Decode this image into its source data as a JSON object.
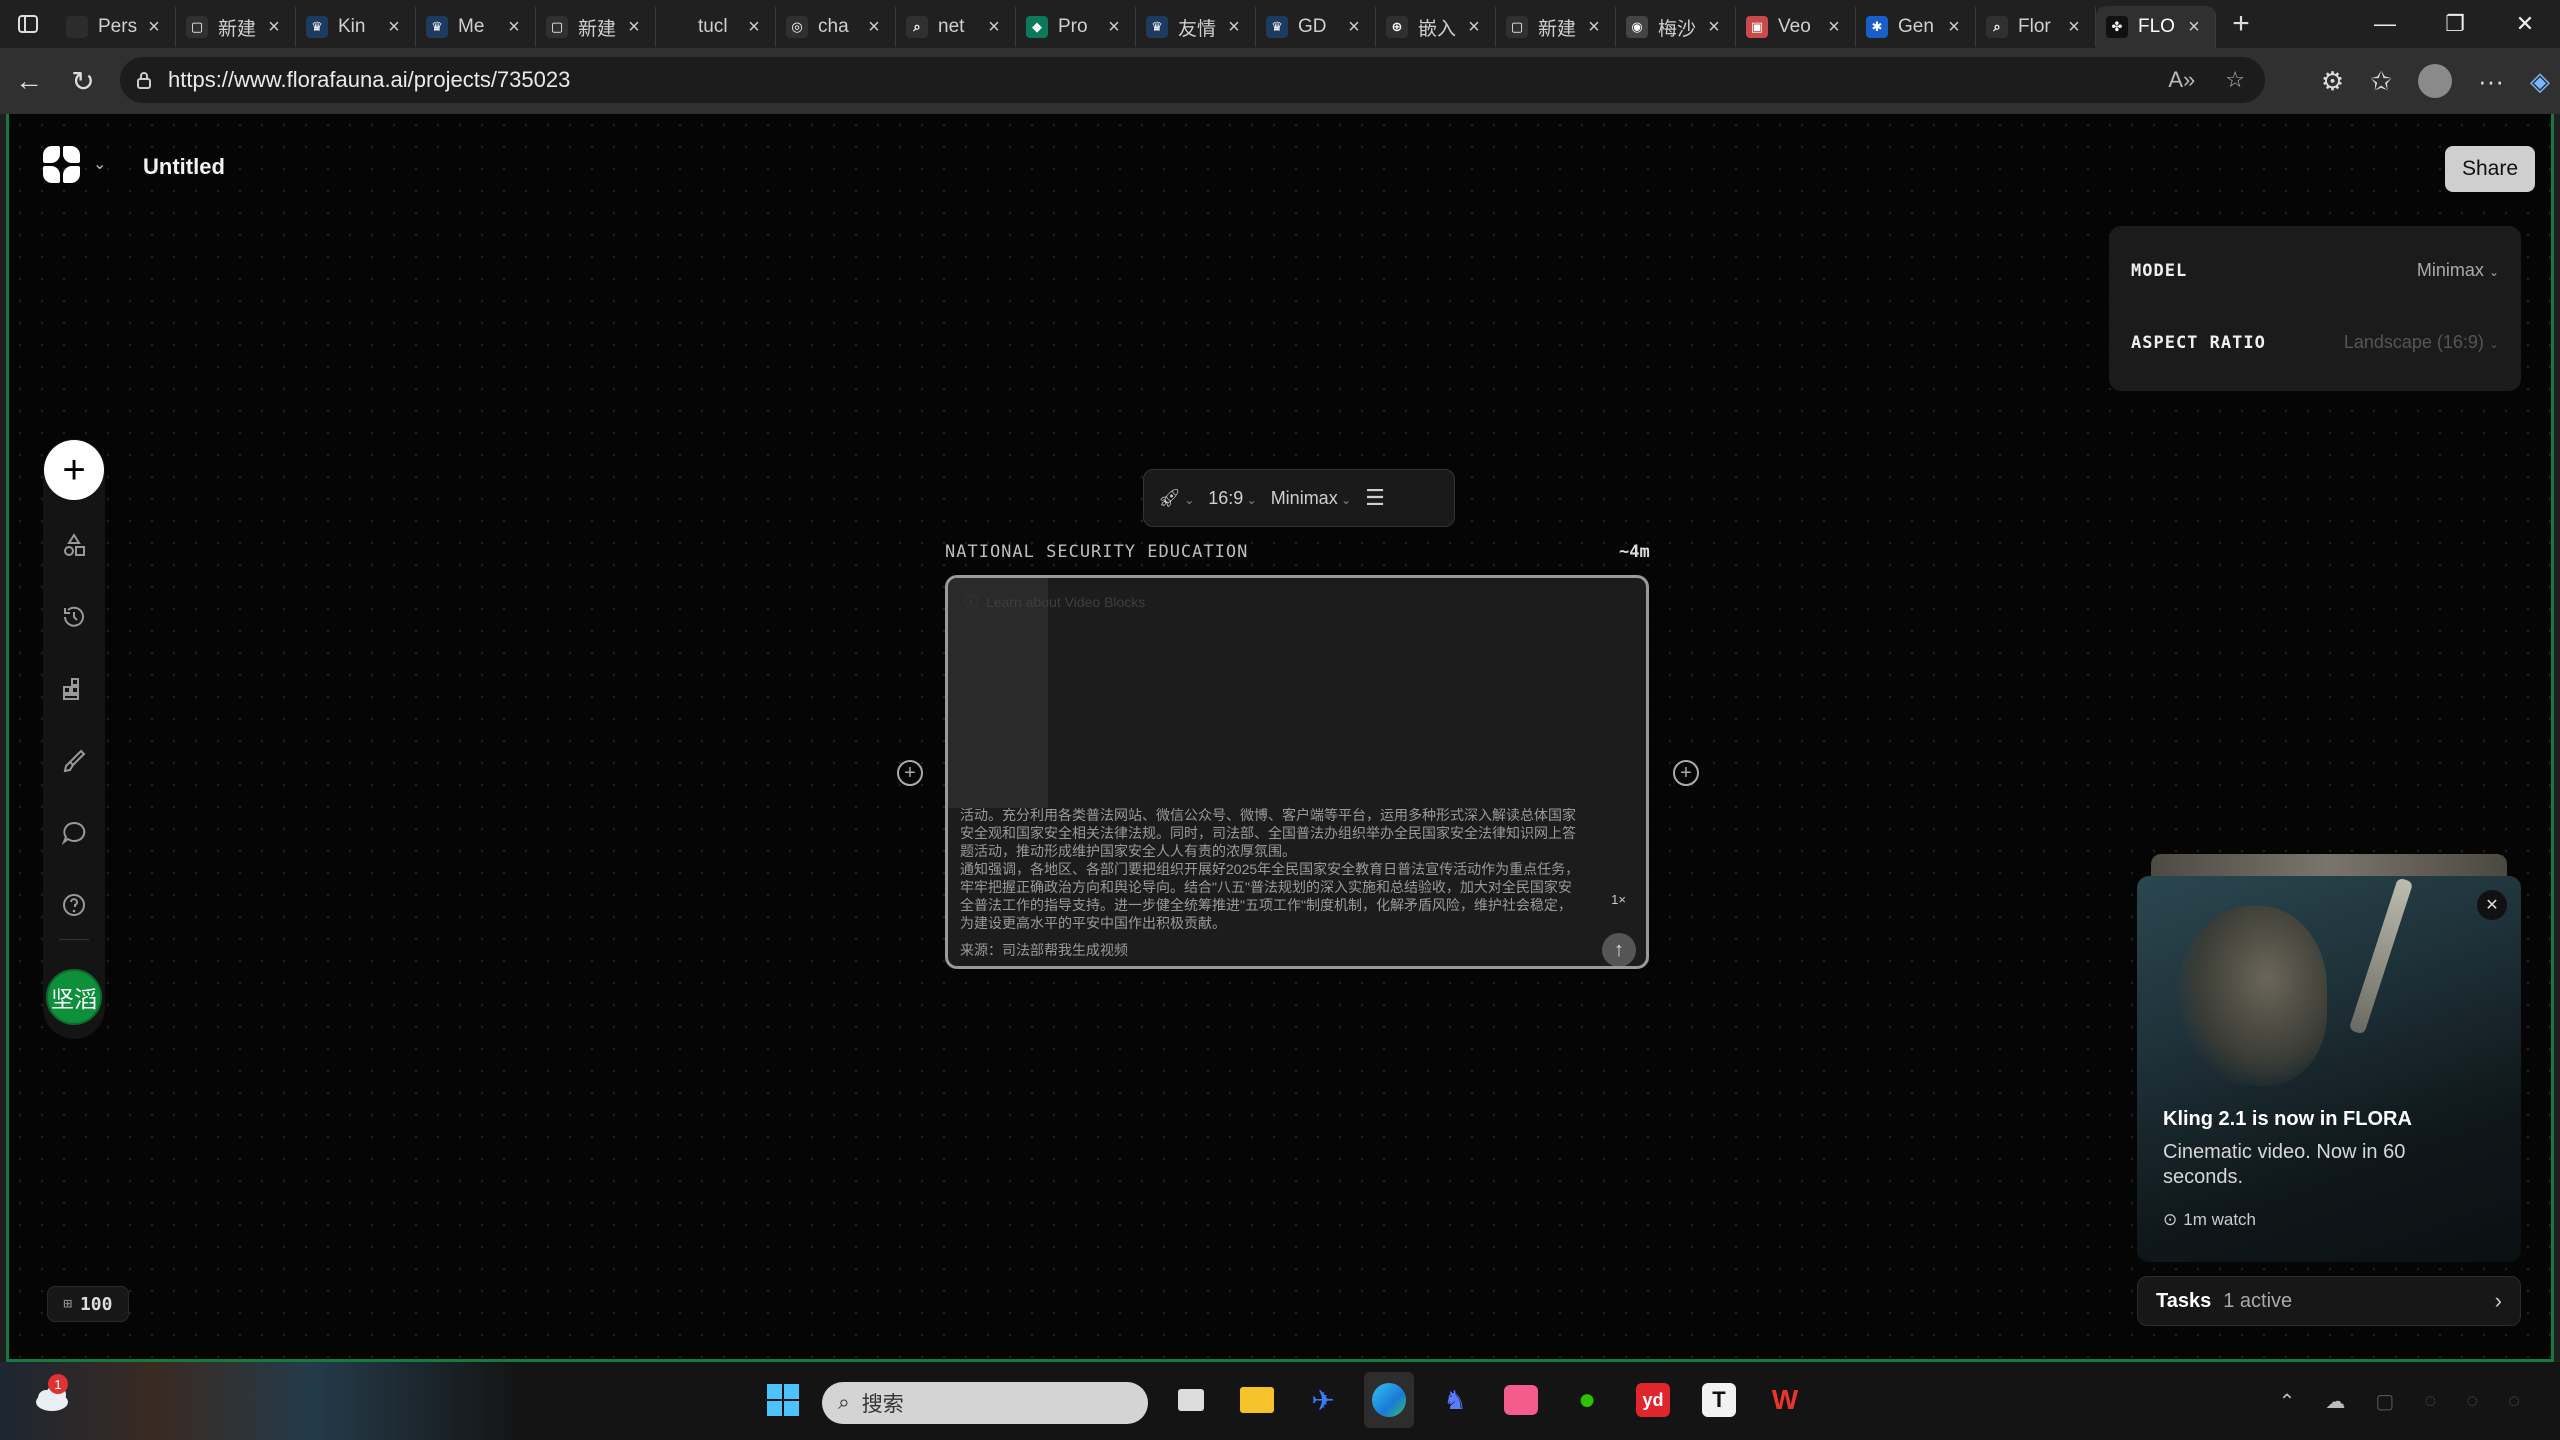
{
  "browser": {
    "tabs": [
      {
        "label": "Pers",
        "fav": "#2c2c2c",
        "glyph": ""
      },
      {
        "label": "新建",
        "fav": "#303030",
        "glyph": "▢"
      },
      {
        "label": "Kin",
        "fav": "#1d3b5e",
        "glyph": "♛"
      },
      {
        "label": "Me",
        "fav": "#1d3b5e",
        "glyph": "♛"
      },
      {
        "label": "新建",
        "fav": "#303030",
        "glyph": "▢"
      },
      {
        "label": "tucl",
        "fav": "#202020",
        "glyph": ""
      },
      {
        "label": "cha",
        "fav": "#303030",
        "glyph": "◎"
      },
      {
        "label": "net",
        "fav": "#303030",
        "glyph": "⌕"
      },
      {
        "label": "Pro",
        "fav": "#0a7a5a",
        "glyph": "◆"
      },
      {
        "label": "友情",
        "fav": "#1d3b5e",
        "glyph": "♛"
      },
      {
        "label": "GD",
        "fav": "#1d3b5e",
        "glyph": "♛"
      },
      {
        "label": "嵌入",
        "fav": "#303030",
        "glyph": "⊕"
      },
      {
        "label": "新建",
        "fav": "#303030",
        "glyph": "▢"
      },
      {
        "label": "梅沙",
        "fav": "#444",
        "glyph": "◉"
      },
      {
        "label": "Veo",
        "fav": "#c94a4a",
        "glyph": "▣"
      },
      {
        "label": "Gen",
        "fav": "#1a5fc9",
        "glyph": "✱"
      },
      {
        "label": "Flor",
        "fav": "#303030",
        "glyph": "⌕"
      },
      {
        "label": "FLO",
        "fav": "#111",
        "glyph": "✤"
      }
    ],
    "url": "https://www.florafauna.ai/projects/735023"
  },
  "app": {
    "title": "Untitled",
    "share_label": "Share",
    "settings": {
      "model_label": "MODEL",
      "model_value": "Minimax",
      "aspect_label": "ASPECT RATIO",
      "aspect_value": "Landscape (16:9)"
    },
    "user_initials": "坚滔",
    "credits": "100",
    "toolbar": {
      "ratio": "16:9",
      "model": "Minimax"
    },
    "block": {
      "label": "NATIONAL SECURITY EDUCATION",
      "time": "~4m",
      "learn": "Learn about Video Blocks",
      "text": "活动。充分利用各类普法网站、微信公众号、微博、客户端等平台，运用多种形式深入解读总体国家安全观和国家安全相关法律法规。同时，司法部、全国普法办组织举办全民国家安全法律知识网上答题活动，推动形成维护国家安全人人有责的浓厚氛围。\n通知强调，各地区、各部门要把组织开展好2025年全民国家安全教育日普法宣传活动作为重点任务，牢牢把握正确政治方向和舆论导向。结合\"八五\"普法规划的深入实施和总结验收，加大对全民国家安全普法工作的指导支持。进一步健全统筹推进\"五项工作\"制度机制，化解矛盾风险，维护社会稳定，为建设更高水平的平安中国作出积极贡献。",
      "source": "来源：司法部帮我生成视频",
      "multiplier": "1×"
    },
    "promo": {
      "title": "Kling 2.1 is now in FLORA",
      "desc": "Cinematic video. Now in 60 seconds.",
      "watch": "1m watch"
    },
    "tasks": {
      "label": "Tasks",
      "active": "1 active"
    }
  },
  "taskbar": {
    "search_placeholder": "搜索",
    "weather_badge": "1"
  }
}
